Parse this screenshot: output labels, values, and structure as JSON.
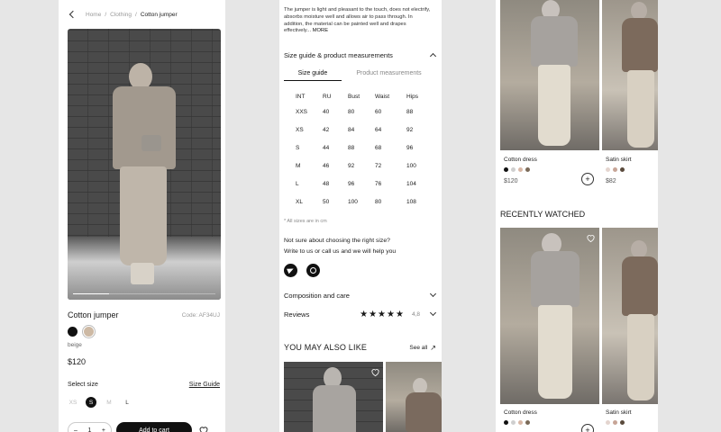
{
  "product": {
    "breadcrumb": [
      "Home",
      "Clothing",
      "Cotton jumper"
    ],
    "name": "Cotton jumper",
    "code": "Code: AF34UJ",
    "color_name": "beige",
    "colors": [
      "#111111",
      "#cdb9a4"
    ],
    "price": "$120",
    "select_size_label": "Select size",
    "size_guide_link": "Size Guide",
    "sizes": [
      "XS",
      "S",
      "M",
      "L"
    ],
    "selected_size": "S",
    "quantity": "1",
    "qty_minus": "–",
    "qty_plus": "+",
    "add_to_cart": "Add to cart"
  },
  "details": {
    "description": "The jumper is light and pleasant to the touch, does not electrify, absorbs moisture well and allows air to pass through. In addition, the material can be painted well and drapes effectively...",
    "more": "MORE",
    "size_section": "Size guide & product measurements",
    "tabs": [
      "Size guide",
      "Product measurements"
    ],
    "table_headers": [
      "INT",
      "RU",
      "Bust",
      "Waist",
      "Hips"
    ],
    "table_rows": [
      [
        "XXS",
        "40",
        "80",
        "60",
        "88"
      ],
      [
        "XS",
        "42",
        "84",
        "64",
        "92"
      ],
      [
        "S",
        "44",
        "88",
        "68",
        "96"
      ],
      [
        "M",
        "46",
        "92",
        "72",
        "100"
      ],
      [
        "L",
        "48",
        "96",
        "76",
        "104"
      ],
      [
        "XL",
        "50",
        "100",
        "80",
        "108"
      ]
    ],
    "note": "* All sizes are in cm",
    "help_question": "Not sure about choosing the right size?",
    "help_text": "Write to us or call us and we will help you",
    "composition": "Composition and care",
    "reviews": "Reviews",
    "stars": "★★★★★",
    "rating": "4,8",
    "also_like_title": "YOU MAY ALSO LIKE",
    "see_all": "See all",
    "see_all_arrow": "↗"
  },
  "recommend": {
    "items": [
      {
        "name": "Cotton dress",
        "price": "$120",
        "colors": [
          "#111111",
          "#cfcfcf",
          "#d8b7a6",
          "#7b6a58"
        ]
      },
      {
        "name": "Satin skirt",
        "price": "$82",
        "colors": [
          "#e4d5cf",
          "#c7a597",
          "#5a4a3c"
        ]
      }
    ],
    "recent_title": "RECENTLY WATCHED",
    "recent_items": [
      {
        "name": "Cotton dress",
        "colors": [
          "#111111",
          "#cfcfcf",
          "#d8b7a6",
          "#7b6a58"
        ]
      },
      {
        "name": "Satin skirt",
        "colors": [
          "#e4d5cf",
          "#c7a597",
          "#5a4a3c"
        ]
      }
    ],
    "add_symbol": "+"
  }
}
